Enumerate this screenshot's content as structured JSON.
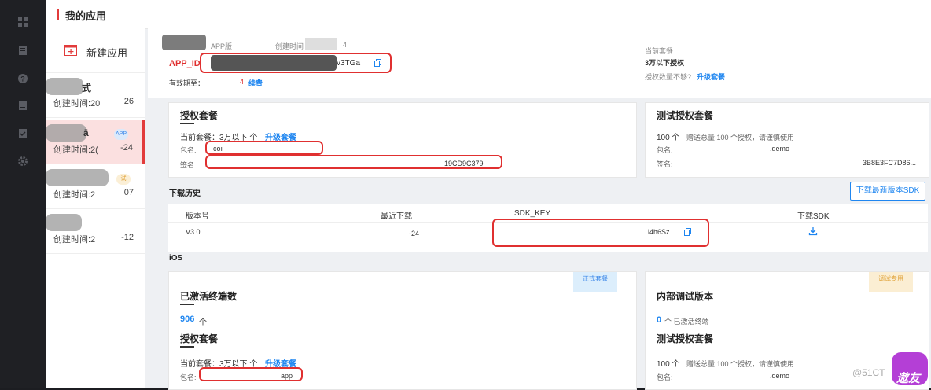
{
  "page": {
    "title": "我的应用"
  },
  "sidebar": {
    "icons": [
      "grid-icon",
      "document-icon",
      "help-icon",
      "clipboard-icon",
      "checklist-icon",
      "gear-icon"
    ]
  },
  "applist": {
    "new_app_label": "新建应用",
    "items": [
      {
        "name": "式",
        "date": "创建时间:20",
        "count": "26",
        "badge": ""
      },
      {
        "name": "ā",
        "date": "创建时间:2(",
        "count": "-24",
        "badge": "APP"
      },
      {
        "name": "",
        "date": "创建时间:2",
        "count": "07",
        "badge": "试"
      },
      {
        "name": "",
        "date": "创建时间:2",
        "count": "-12",
        "badge": ""
      }
    ]
  },
  "header": {
    "app_meta": "APP版",
    "created_label": "创建时间",
    "created_value": "4",
    "app_id_label": "APP_ID",
    "app_id_value": "v3TGa",
    "valid_label": "有效期至：",
    "valid_value": "4",
    "renew": "续费",
    "current_plan_label": "当前套餐",
    "current_plan_value": "3万以下授权",
    "need_more": "授权数量不够?",
    "upgrade": "升级套餐"
  },
  "license": {
    "title": "授权套餐",
    "current_plan": "当前套餐：3万以下 个",
    "upgrade": "升级套餐",
    "package_label": "包名:",
    "package_value": "coı",
    "sign_label": "签名:",
    "sign_value": "19CD9C379"
  },
  "test_license": {
    "title": "测试授权套餐",
    "count": "100 个",
    "desc": "赠送总量 100 个授权，请谨慎使用",
    "package_label": "包名:",
    "package_value": ".demo",
    "sign_label": "签名:",
    "sign_value": "3B8E3FC7D86..."
  },
  "download": {
    "section_title": "下载历史",
    "button": "下载最新版本SDK",
    "columns": [
      "版本号",
      "最近下载",
      "SDK_KEY",
      "下载SDK"
    ],
    "row": {
      "version": "V3.0",
      "last": "-24",
      "key": "l4h6Sz ..."
    }
  },
  "ios": {
    "section_title": "iOS",
    "tag_official": "正式套餐",
    "tag_debug": "调试专用",
    "active_title": "已激活终端数",
    "active_count": "906",
    "active_unit": "个",
    "license_title": "授权套餐",
    "current_plan": "当前套餐：3万以下 个",
    "upgrade": "升级套餐",
    "package_label": "包名:",
    "package_value": "app",
    "debug_title": "内部调试版本",
    "debug_count": "0",
    "debug_desc": "个 已激活终端",
    "test_title": "测试授权套餐",
    "test_count": "100 个",
    "test_desc": "赠送总量 100 个授权，请谨慎使用",
    "test_package_label": "包名:",
    "test_package_value": ".demo"
  },
  "watermark": {
    "text": "@51CT",
    "logo": "遨友"
  },
  "colors": {
    "accent": "#1f86f0",
    "danger": "#e03030",
    "selected": "#fbe0e0"
  }
}
